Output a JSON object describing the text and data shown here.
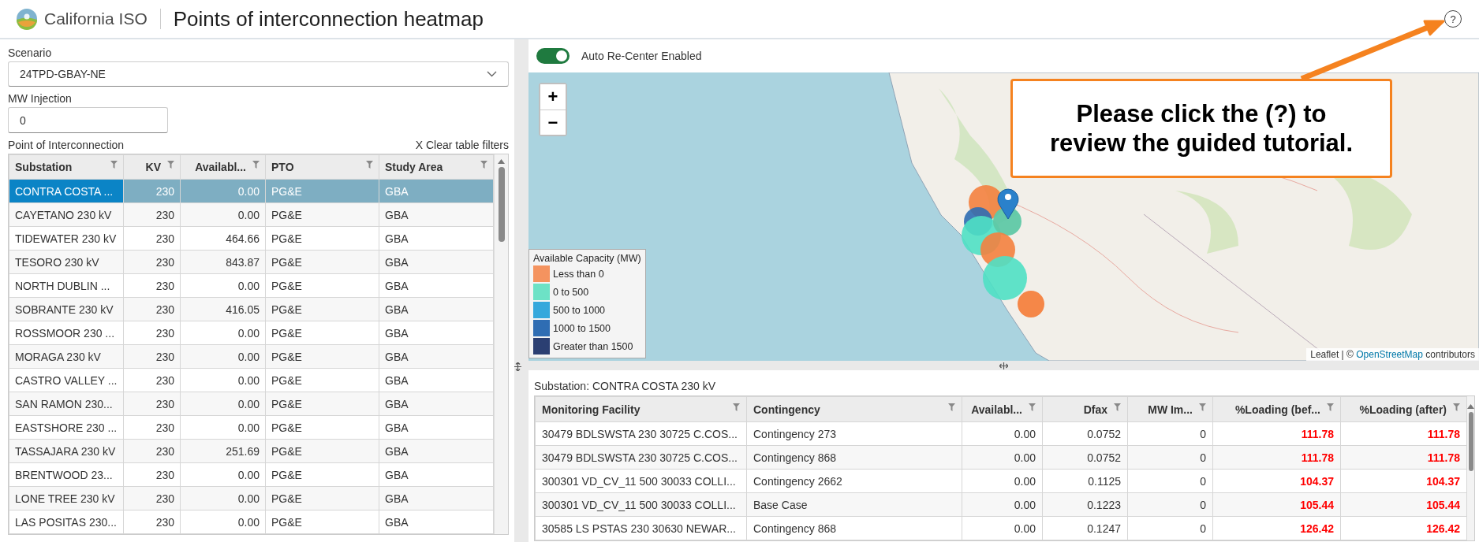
{
  "header": {
    "brand": "California ISO",
    "title": "Points of interconnection heatmap",
    "help": "?"
  },
  "scenario": {
    "label": "Scenario",
    "value": "24TPD-GBAY-NE"
  },
  "mw_injection": {
    "label": "MW Injection",
    "value": "0"
  },
  "poi_table": {
    "title": "Point of Interconnection",
    "clear_filters": "X Clear table filters",
    "columns": [
      "Substation",
      "KV",
      "Availabl...",
      "PTO",
      "Study Area"
    ],
    "rows": [
      {
        "cells": [
          "CONTRA COSTA ...",
          "230",
          "0.00",
          "PG&E",
          "GBA"
        ],
        "selected": true
      },
      {
        "cells": [
          "CAYETANO 230 kV",
          "230",
          "0.00",
          "PG&E",
          "GBA"
        ],
        "selected": false
      },
      {
        "cells": [
          "TIDEWATER 230 kV",
          "230",
          "464.66",
          "PG&E",
          "GBA"
        ],
        "selected": false
      },
      {
        "cells": [
          "TESORO 230 kV",
          "230",
          "843.87",
          "PG&E",
          "GBA"
        ],
        "selected": false
      },
      {
        "cells": [
          "NORTH DUBLIN ...",
          "230",
          "0.00",
          "PG&E",
          "GBA"
        ],
        "selected": false
      },
      {
        "cells": [
          "SOBRANTE 230 kV",
          "230",
          "416.05",
          "PG&E",
          "GBA"
        ],
        "selected": false
      },
      {
        "cells": [
          "ROSSMOOR 230 ...",
          "230",
          "0.00",
          "PG&E",
          "GBA"
        ],
        "selected": false
      },
      {
        "cells": [
          "MORAGA 230 kV",
          "230",
          "0.00",
          "PG&E",
          "GBA"
        ],
        "selected": false
      },
      {
        "cells": [
          "CASTRO VALLEY ...",
          "230",
          "0.00",
          "PG&E",
          "GBA"
        ],
        "selected": false
      },
      {
        "cells": [
          "SAN RAMON 230...",
          "230",
          "0.00",
          "PG&E",
          "GBA"
        ],
        "selected": false
      },
      {
        "cells": [
          "EASTSHORE 230 ...",
          "230",
          "0.00",
          "PG&E",
          "GBA"
        ],
        "selected": false
      },
      {
        "cells": [
          "TASSAJARA 230 kV",
          "230",
          "251.69",
          "PG&E",
          "GBA"
        ],
        "selected": false
      },
      {
        "cells": [
          "BRENTWOOD 23...",
          "230",
          "0.00",
          "PG&E",
          "GBA"
        ],
        "selected": false
      },
      {
        "cells": [
          "LONE TREE 230 kV",
          "230",
          "0.00",
          "PG&E",
          "GBA"
        ],
        "selected": false
      },
      {
        "cells": [
          "LAS POSITAS 230...",
          "230",
          "0.00",
          "PG&E",
          "GBA"
        ],
        "selected": false
      }
    ]
  },
  "map": {
    "auto_recenter": {
      "label": "Auto Re-Center Enabled",
      "on": true
    },
    "zoom_in": "+",
    "zoom_out": "−",
    "legend": {
      "title": "Available Capacity (MW)",
      "items": [
        {
          "label": "Less than 0",
          "color": "#f4935f"
        },
        {
          "label": "0 to 500",
          "color": "#6de2c6"
        },
        {
          "label": "500 to 1000",
          "color": "#35a8dc"
        },
        {
          "label": "1000 to 1500",
          "color": "#2f6db3"
        },
        {
          "label": "Greater than 1500",
          "color": "#2b3f72"
        }
      ]
    },
    "attribution": {
      "before": "Leaflet | © ",
      "link": "OpenStreetMap",
      "after": " contributors"
    }
  },
  "callout": {
    "text": "Please click the (?) to review the guided tutorial."
  },
  "detail": {
    "title": "Substation: CONTRA COSTA 230 kV",
    "columns": [
      "Monitoring Facility",
      "Contingency",
      "Availabl...",
      "Dfax",
      "MW Im...",
      "%Loading (bef...",
      "%Loading (after)"
    ],
    "rows": [
      {
        "cells": [
          "30479 BDLSWSTA 230 30725 C.COS...",
          "Contingency 273",
          "0.00",
          "0.0752",
          "0",
          "111.78",
          "111.78"
        ],
        "overloaded": true
      },
      {
        "cells": [
          "30479 BDLSWSTA 230 30725 C.COS...",
          "Contingency 868",
          "0.00",
          "0.0752",
          "0",
          "111.78",
          "111.78"
        ],
        "overloaded": true
      },
      {
        "cells": [
          "300301 VD_CV_11 500 30033 COLLI...",
          "Contingency 2662",
          "0.00",
          "0.1125",
          "0",
          "104.37",
          "104.37"
        ],
        "overloaded": true
      },
      {
        "cells": [
          "300301 VD_CV_11 500 30033 COLLI...",
          "Base Case",
          "0.00",
          "0.1223",
          "0",
          "105.44",
          "105.44"
        ],
        "overloaded": true
      },
      {
        "cells": [
          "30585 LS PSTAS 230 30630 NEWAR...",
          "Contingency 868",
          "0.00",
          "0.1247",
          "0",
          "126.42",
          "126.42"
        ],
        "overloaded": true
      }
    ]
  }
}
